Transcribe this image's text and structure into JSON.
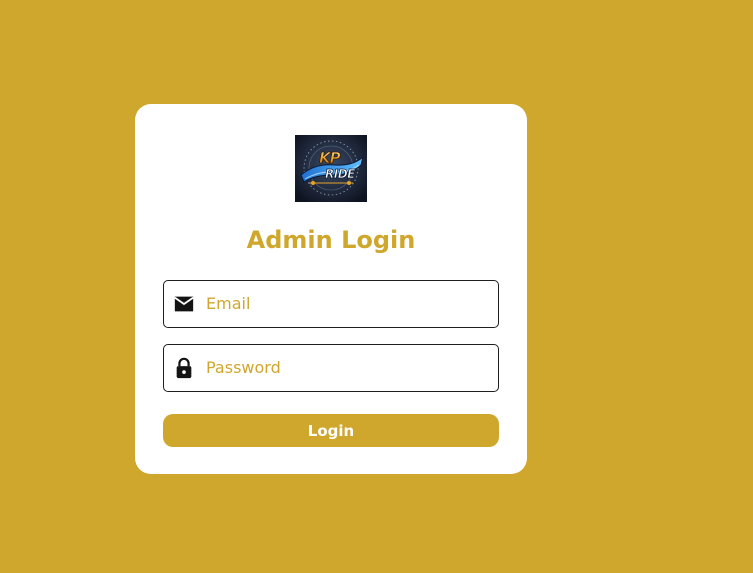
{
  "colors": {
    "background": "#cfa72d",
    "card": "#ffffff",
    "accent": "#cfa72d",
    "border": "#1f1f1f"
  },
  "logo": {
    "icon": "kp-ride-logo"
  },
  "login": {
    "title": "Admin Login",
    "email": {
      "icon": "mail-icon",
      "placeholder": "Email",
      "value": ""
    },
    "password": {
      "icon": "lock-icon",
      "placeholder": "Password",
      "value": ""
    },
    "button_label": "Login"
  }
}
